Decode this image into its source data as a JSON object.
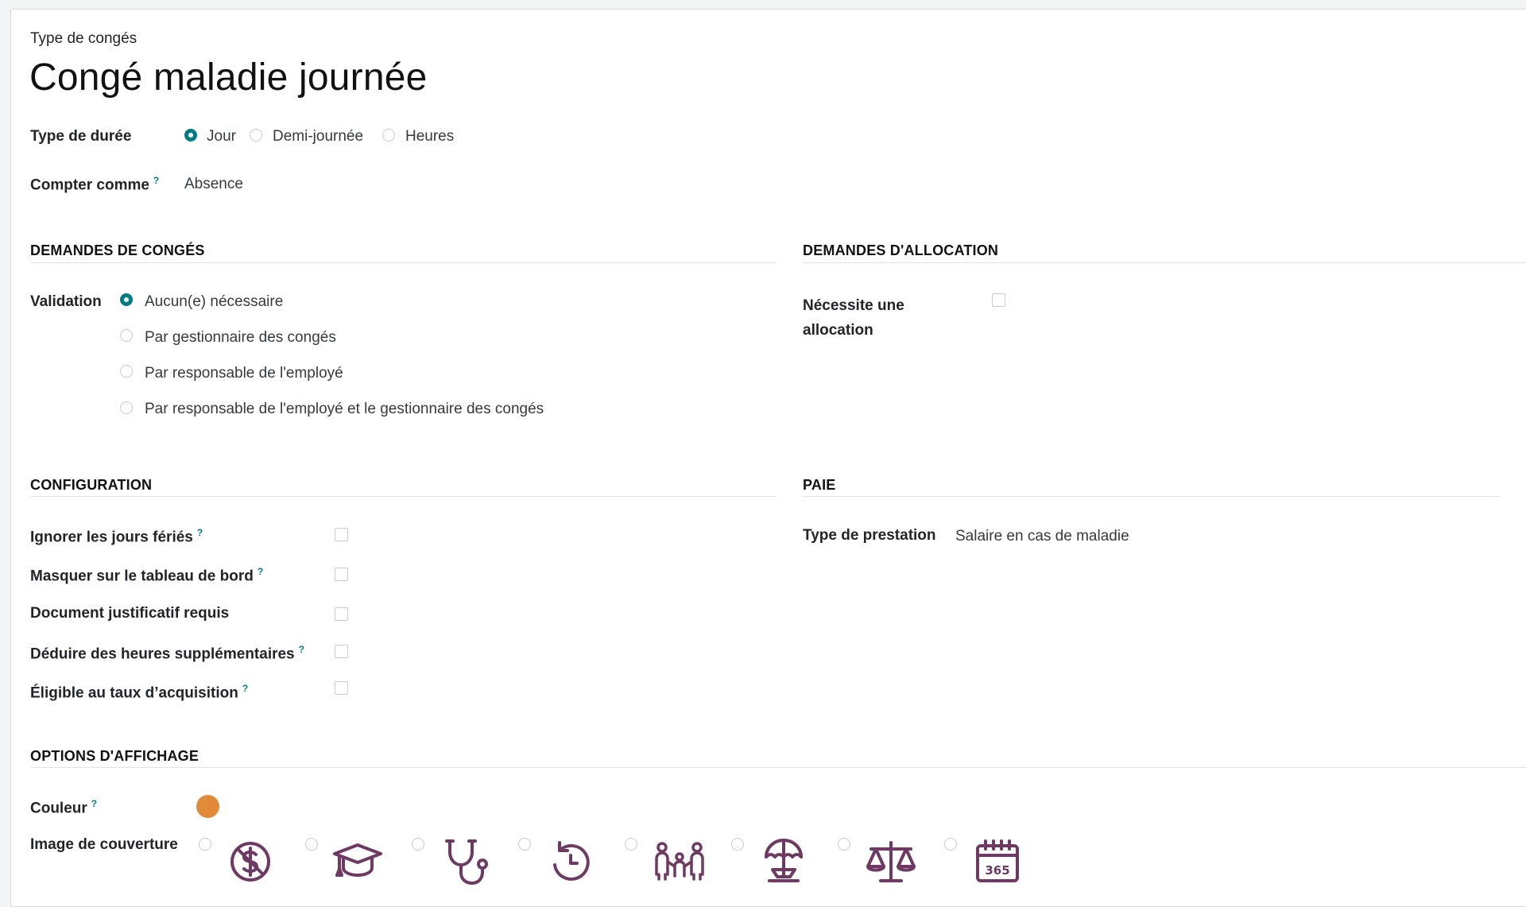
{
  "header": {
    "breadcrumb": "Type de congés",
    "title": "Congé maladie journée"
  },
  "general": {
    "duration_type": {
      "label": "Type de durée",
      "options": [
        "Jour",
        "Demi-journée",
        "Heures"
      ],
      "selected": "Jour"
    },
    "count_as": {
      "label": "Compter comme",
      "help": "?",
      "value": "Absence"
    }
  },
  "leave_requests": {
    "title": "DEMANDES DE CONGÉS",
    "validation": {
      "label": "Validation",
      "options": [
        "Aucun(e) nécessaire",
        "Par gestionnaire des congés",
        "Par responsable de l'employé",
        "Par responsable de l'employé et le gestionnaire des congés"
      ],
      "selected": "Aucun(e) nécessaire"
    }
  },
  "allocation_requests": {
    "title": "DEMANDES D'ALLOCATION",
    "requires_allocation": {
      "label_line1": "Nécessite une",
      "label_line2": "allocation",
      "checked": false
    }
  },
  "configuration": {
    "title": "CONFIGURATION",
    "help": "?",
    "fields": [
      {
        "label": "Ignorer les jours fériés",
        "help": true,
        "checked": false
      },
      {
        "label": "Masquer sur le tableau de bord",
        "help": true,
        "checked": false
      },
      {
        "label": "Document justificatif requis",
        "help": false,
        "checked": false
      },
      {
        "label": "Déduire des heures supplémentaires",
        "help": true,
        "checked": false
      },
      {
        "label": "Éligible au taux d’acquisition",
        "help": true,
        "checked": false
      }
    ]
  },
  "payroll": {
    "title": "PAIE",
    "benefit_type": {
      "label": "Type de prestation",
      "value": "Salaire en cas de maladie"
    }
  },
  "display_options": {
    "title": "OPTIONS D'AFFICHAGE",
    "color": {
      "label": "Couleur",
      "help": "?",
      "value": "#e08a3a"
    },
    "cover_image": {
      "label": "Image de couverture",
      "icon_color": "#6e3a63",
      "options": [
        "dollar-circle-icon",
        "graduation-cap-icon",
        "stethoscope-icon",
        "history-arrow-icon",
        "family-icon",
        "beach-umbrella-icon",
        "balance-scale-icon",
        "calendar-365-icon"
      ]
    }
  },
  "colors": {
    "accent": "#017e84"
  }
}
